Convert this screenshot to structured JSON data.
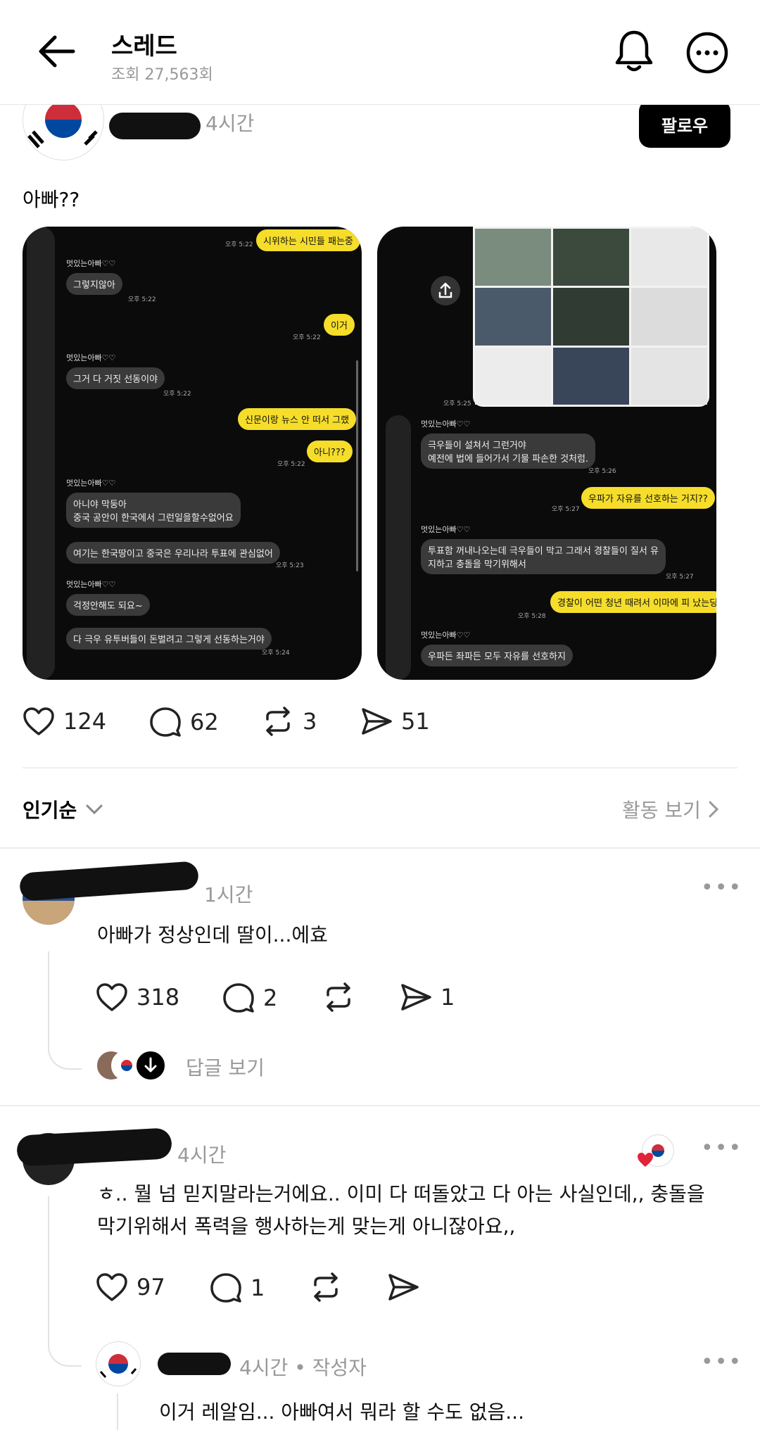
{
  "header": {
    "title": "스레드",
    "views": "조회 27,563회"
  },
  "post": {
    "time": "4시간",
    "follow_label": "팔로우",
    "text": "아빠??",
    "likes": "124",
    "comments": "62",
    "reposts": "3",
    "shares": "51"
  },
  "left_chat": {
    "name": "멋있는아빠♡♡",
    "t1": "오후 5:22",
    "t2": "오후 5:23",
    "t3": "오후 5:24",
    "y1": "시위하는 시민들 패는중",
    "g1": "그렇지않아",
    "y2": "이거",
    "g2": "그거 다 거짓 선동이야",
    "y3": "신문이랑 뉴스 안 떠서 그랬",
    "y4": "아니???",
    "g3a": "아니야 막둥아",
    "g3b": "중국 공안이 한국에서 그런일을할수없어요",
    "g4": "여기는 한국땅이고 중국은 우리나라 투표에 관심없어",
    "g5": "걱정안해도 되요~",
    "g6": "다 극우 유투버들이 돈벌려고 그렇게 선동하는거야"
  },
  "right_chat": {
    "name": "멋있는아빠♡♡",
    "t1": "오후 5:25",
    "t2": "오후 5:26",
    "t3": "오후 5:27",
    "t4": "오후 5:28",
    "g1a": "극우들이 설쳐서 그런거야",
    "g1b": "예전에 법에 들어가서 기물 파손한 것처럼.",
    "y1": "우파가 자유를 선호하는 거지??",
    "g2a": "투표함 꺼내나오는데 극우들이 막고 그래서 경찰들이 질서 유",
    "g2b": "지하고 충돌을 막기위해서",
    "y2": "경찰이 어떤 청년 때려서 이마에 피 났는딩",
    "g3": "우파든 좌파든 모두 자유를 선호하지"
  },
  "sort": {
    "label": "인기순",
    "activity": "활동 보기"
  },
  "comment1": {
    "time": "1시간",
    "text": "아빠가 정상인데 딸이...에효",
    "likes": "318",
    "replies": "2",
    "shares": "1",
    "view_replies": "답글 보기"
  },
  "comment2": {
    "time": "4시간",
    "text_line1": "ㅎ.. 뭘 넘 믿지말라는거에요.. 이미 다 떠돌았고 다 아는 사실인데,, 충돌을",
    "text_line2": "막기위해서 폭력을 행사하는게 맞는게 아니잖아요,,",
    "likes": "97",
    "replies": "1"
  },
  "reply": {
    "meta": "4시간 • 작성자",
    "text": "이거 레알임... 아빠여서 뭐라 할 수도 없음..."
  },
  "colors": {
    "accent_yellow": "#f5dd2a",
    "like_red": "#e0243a"
  }
}
